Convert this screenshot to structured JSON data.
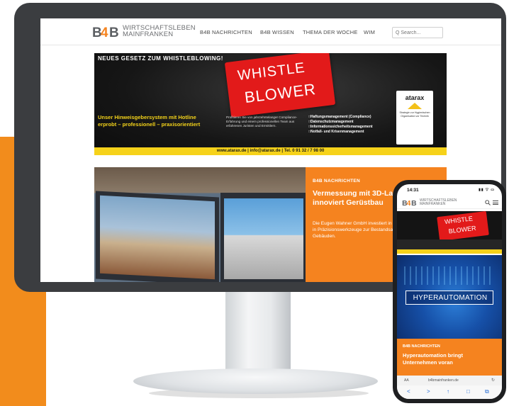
{
  "brand": {
    "logo_mark": "B4B",
    "logo_line1": "WIRTSCHAFTSLEBEN",
    "logo_line2": "MAINFRANKEN"
  },
  "nav": {
    "items": [
      {
        "label": "B4B NACHRICHTEN"
      },
      {
        "label": "B4B WISSEN"
      },
      {
        "label": "THEMA DER WOCHE"
      },
      {
        "label": "WIM"
      }
    ],
    "search_placeholder": "Q Search..."
  },
  "ad": {
    "headline": "NEUES GESETZ ZUM WHISTLEBLOWING!",
    "sign_line1": "WHISTLE",
    "sign_line2": "BLOWER",
    "claim_line1": "Unser Hinweisgebersystem mit Hotline",
    "claim_line2": "erprobt – professionell – praxisorientiert",
    "description": "Profitieren Sie von jahrzehntelanger Compliance-Erfahrung und einem professionellen Team aus erfahrenen Juristen und Ermittlern.",
    "list": [
      "Haftungsmanagement (Compliance)",
      "Datenschutzmanagement",
      "Informationssicherheitsmanagement",
      "Notfall- und Krisenmanagement"
    ],
    "badge_name": "atarax",
    "badge_tagline": "Strategie zur Hygienischen Organisation vor Technik",
    "footer": "www.atarax.de  |  info@atarax.de  |  Tel. 0 91 32 / 7 98 00"
  },
  "featured": {
    "kicker": "B4B NACHRICHTEN",
    "title": "Vermessung mit 3D-Laserscan innoviert Gerüstbau",
    "excerpt": "Die Eugen Wahner GmbH investiert in Digitalisierung, genauer in Präzisionswerkzeuge zur Bestandsaufnahme von Gebäuden."
  },
  "phone": {
    "time": "14:31",
    "status_icons": "▮▮ ▽ ▭",
    "hero_label": "HYPERAUTOMATION",
    "kicker": "B4B NACHRICHTEN",
    "title": "Hyperautomation bringt Unternehmen voran",
    "url_aa": "AA",
    "url": "b4bmainfranken.de",
    "reload": "↻",
    "toolbar": [
      "<",
      ">",
      "↑",
      "□",
      "⧉"
    ]
  },
  "colors": {
    "accent_orange": "#f5831f",
    "ad_yellow": "#f6d21a",
    "whistle_red": "#e21a1a",
    "monitor_frame": "#3b3d40"
  }
}
